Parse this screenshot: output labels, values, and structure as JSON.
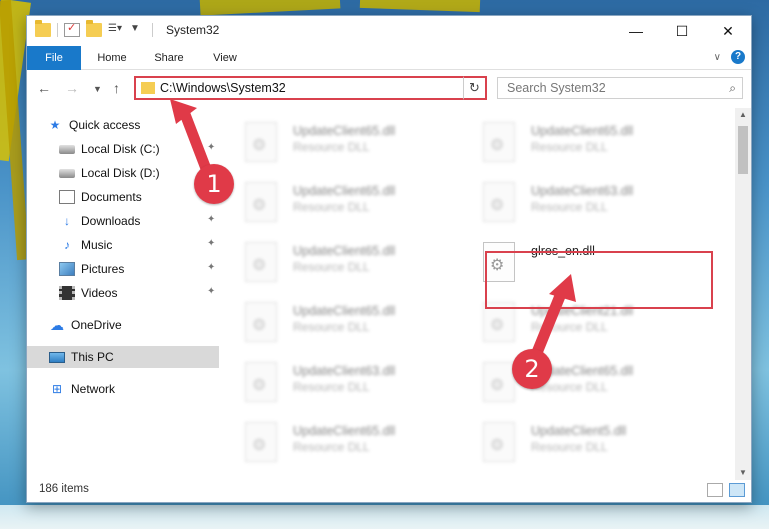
{
  "window": {
    "title": "System32",
    "caption": {
      "minimize": "—",
      "maximize": "☐",
      "close": "✕"
    }
  },
  "ribbon": {
    "tabs": [
      "File",
      "Home",
      "Share",
      "View"
    ],
    "help": "?"
  },
  "address": {
    "path": "C:\\Windows\\System32"
  },
  "search": {
    "placeholder": "Search System32"
  },
  "navpane": {
    "items": [
      {
        "label": "Quick access",
        "icon": "quick-access-star-icon"
      },
      {
        "label": "Local Disk (C:)",
        "icon": "drive-icon",
        "pinned": true
      },
      {
        "label": "Local Disk (D:)",
        "icon": "drive-icon"
      },
      {
        "label": "Documents",
        "icon": "documents-icon",
        "pinned": true
      },
      {
        "label": "Downloads",
        "icon": "downloads-icon",
        "pinned": true
      },
      {
        "label": "Music",
        "icon": "music-icon",
        "pinned": true
      },
      {
        "label": "Pictures",
        "icon": "pictures-icon",
        "pinned": true
      },
      {
        "label": "Videos",
        "icon": "videos-icon",
        "pinned": true
      },
      {
        "label": "OneDrive",
        "icon": "onedrive-icon"
      },
      {
        "label": "This PC",
        "icon": "this-pc-icon",
        "selected": true
      },
      {
        "label": "Network",
        "icon": "network-icon"
      }
    ]
  },
  "files": [
    {
      "name": "UpdateClient65.dll",
      "type": "Resource DLL"
    },
    {
      "name": "UpdateClient65.dll",
      "type": "Resource DLL"
    },
    {
      "name": "UpdateClient65.dll",
      "type": "Resource DLL"
    },
    {
      "name": "UpdateClient63.dll",
      "type": "Resource DLL"
    },
    {
      "name": "UpdateClient65.dll",
      "type": "Resource DLL"
    },
    {
      "name": "glres_en.dll",
      "type": ""
    },
    {
      "name": "UpdateClient65.dll",
      "type": "Resource DLL"
    },
    {
      "name": "UpdateClient21.dll",
      "type": "Resource DLL"
    },
    {
      "name": "UpdateClient63.dll",
      "type": "Resource DLL"
    },
    {
      "name": "UpdateClient65.dll",
      "type": "Resource DLL"
    },
    {
      "name": "UpdateClient65.dll",
      "type": "Resource DLL"
    },
    {
      "name": "UpdateClient5.dll",
      "type": "Resource DLL"
    }
  ],
  "status": {
    "count": "186 items"
  },
  "annotations": {
    "badge1": "1",
    "badge2": "2",
    "color": "#e03a48"
  }
}
